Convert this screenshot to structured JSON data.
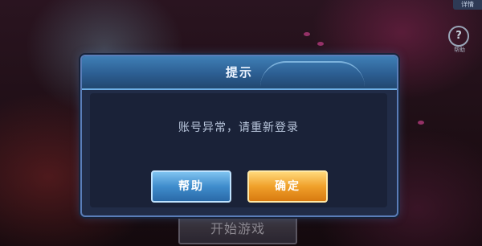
{
  "top_right": {
    "label": "详情"
  },
  "side_help": {
    "icon": "question-icon",
    "glyph": "?",
    "label": "帮助"
  },
  "start_button": {
    "label": "开始游戏"
  },
  "dialog": {
    "title": "提示",
    "message": "账号异常，请重新登录",
    "buttons": {
      "help_label": "帮助",
      "confirm_label": "确定"
    }
  },
  "colors": {
    "dialog_bg": "#212c47",
    "header_blue": "#3f7fb6",
    "help_button_blue": "#3f8ccc",
    "confirm_button_orange": "#f0a02a"
  }
}
